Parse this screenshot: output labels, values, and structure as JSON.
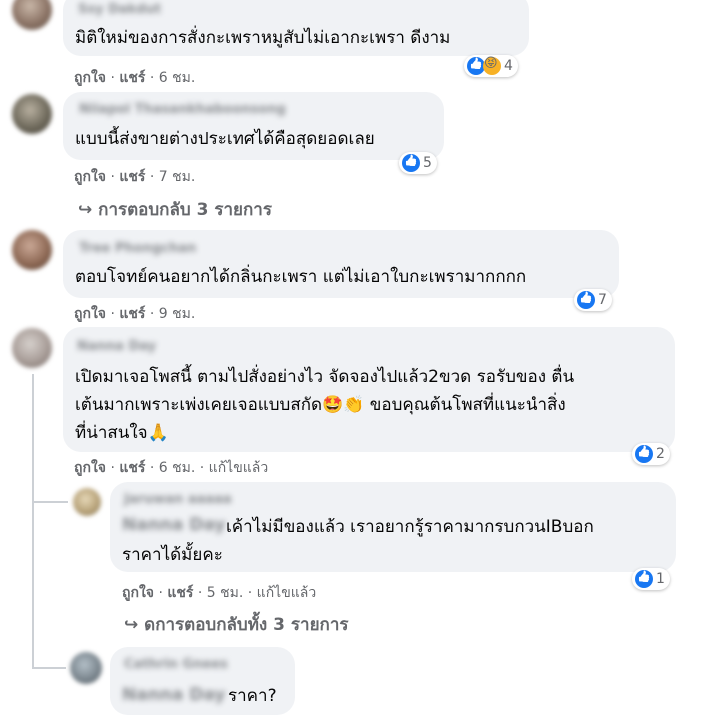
{
  "comments": [
    {
      "text_lines": [
        "มิติใหม่ของการสั่งกะเพราหมูสับไม่เอากะเพรา ดีงาม"
      ],
      "actions": {
        "like": "ถูกใจ",
        "share": "แชร์",
        "time": "6 ชม."
      },
      "reaction_count": "4",
      "reactions": [
        "like-icon",
        "laugh-icon"
      ]
    },
    {
      "text_lines": [
        "แบบนี้ส่งขายต่างประเทศได้คือสุดยอดเลย"
      ],
      "actions": {
        "like": "ถูกใจ",
        "share": "แชร์",
        "time": "7 ชม."
      },
      "reaction_count": "5",
      "reactions": [
        "like-icon"
      ],
      "replies_link": "↪ การตอบกลับ 3 รายการ"
    },
    {
      "text_lines": [
        "ตอบโจทย์คนอยากได้กลิ่นกะเพรา แต่ไม่เอาใบกะเพรามากกกก"
      ],
      "actions": {
        "like": "ถูกใจ",
        "share": "แชร์",
        "time": "9 ชม."
      },
      "reaction_count": "7",
      "reactions": [
        "like-icon"
      ]
    },
    {
      "text_lines": [
        "เปิดมาเจอโพสนี้ ตามไปสั่งอย่างไว จัดจองไปแล้ว2ขวด รอรับของ ตื่น",
        "เต้นมากเพราะเพ่งเคยเจอแบบสกัด🤩👏 ขอบคุณต้นโพสที่แนะนำสิ่ง",
        "ที่น่าสนใจ🙏"
      ],
      "actions": {
        "like": "ถูกใจ",
        "share": "แชร์",
        "time": "6 ชม.",
        "edited": "แก้ไขแล้ว"
      },
      "reaction_count": "2",
      "reactions": [
        "like-icon"
      ]
    }
  ],
  "reply": {
    "text_lines": [
      "เค้าไม่มีของแล้ว เราอยากรู้ราคามากรบกวนIBบอก",
      "ราคาได้มั้ยคะ"
    ],
    "actions": {
      "like": "ถูกใจ",
      "share": "แชร์",
      "time": "5 ชม.",
      "edited": "แก้ไขแล้ว"
    },
    "reaction_count": "1",
    "reactions": [
      "like-icon"
    ],
    "replies_link": "↪ ดการตอบกลับทั้ง 3 รายการ"
  },
  "last_reply": {
    "text": "ราคา?"
  },
  "colors": {
    "bubble": "#f0f2f5",
    "like_blue": "#1877f2",
    "meta_gray": "#65676b"
  }
}
